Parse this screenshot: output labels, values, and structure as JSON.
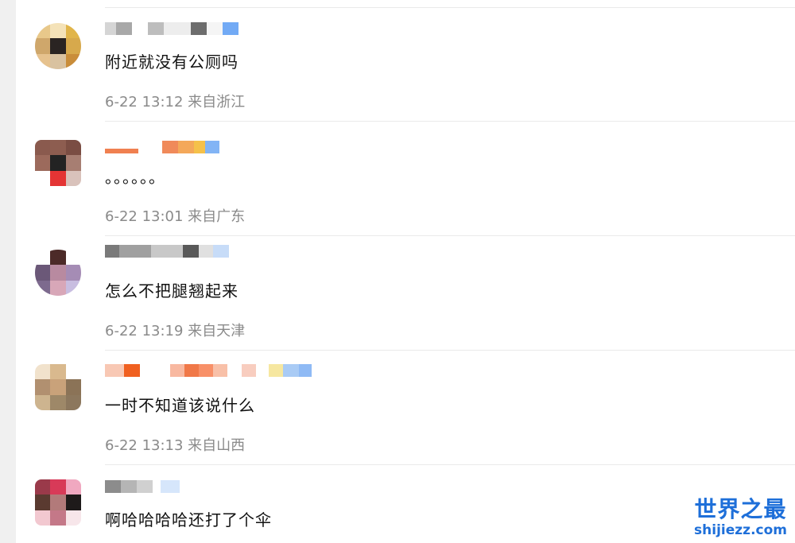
{
  "comments": [
    {
      "text": "附近就没有公厕吗",
      "meta": "6-22 13:12 来自浙江"
    },
    {
      "text": "。。。。。。",
      "meta": "6-22 13:01 来自广东"
    },
    {
      "text": "怎么不把腿翘起来",
      "meta": "6-22 13:19 来自天津"
    },
    {
      "text": "一时不知道该说什么",
      "meta": "6-22 13:13 来自山西"
    },
    {
      "text": "啊哈哈哈哈还打了个伞",
      "meta": ""
    }
  ],
  "watermark": {
    "line1": "世界之最",
    "line2": "shijiezz.com"
  },
  "colors": {
    "accent": "#1e6fd9",
    "meta_text": "#8a8a8a"
  }
}
